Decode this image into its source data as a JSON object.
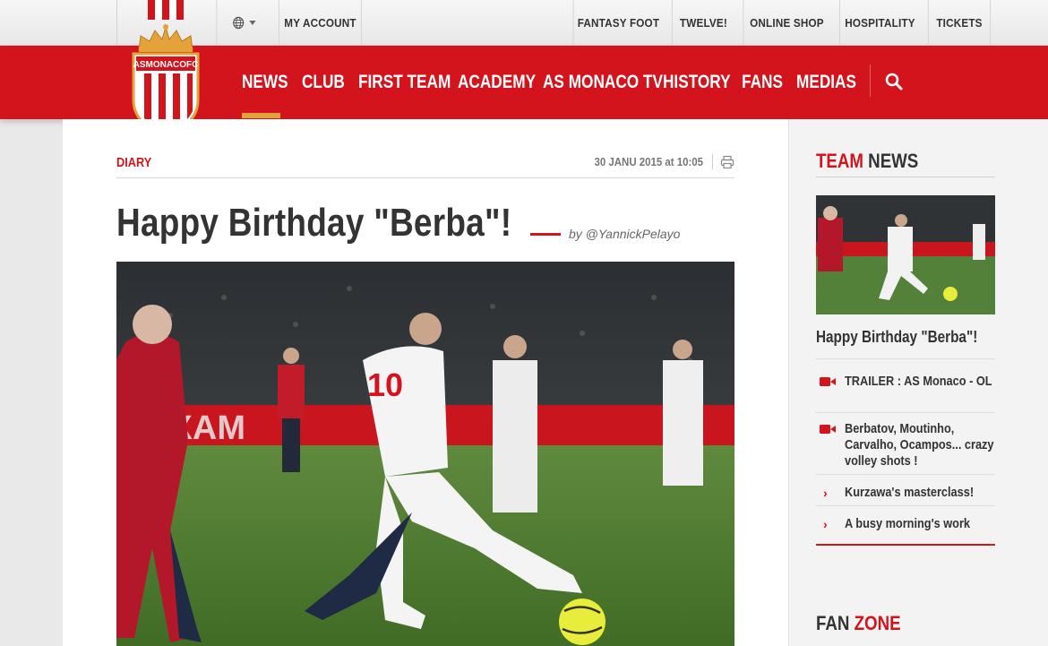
{
  "topbar": {
    "language_icon": "globe-icon",
    "my_account": "MY ACCOUNT",
    "links": [
      "FANTASY FOOT",
      "TWELVE!",
      "ONLINE SHOP",
      "HOSPITALITY",
      "TICKETS"
    ]
  },
  "brand": {
    "logo_text": "ASMONACOFC",
    "colors": {
      "red": "#d3141d",
      "gold": "#e3a23a",
      "white": "#ffffff"
    }
  },
  "nav": {
    "items": [
      "NEWS",
      "CLUB",
      "FIRST TEAM",
      "ACADEMY",
      "AS MONACO TV",
      "HISTORY",
      "FANS",
      "MEDIAS"
    ],
    "active": "NEWS",
    "search_icon": "search-icon"
  },
  "article": {
    "category": "DIARY",
    "date": "30 JANU 2015 at 10:05",
    "print_icon": "print-icon",
    "title": "Happy Birthday \"Berba\"!",
    "byline": "by @YannickPelayo",
    "photo_banner": "OXAM"
  },
  "sidebar": {
    "team_news": {
      "word1": "TEAM",
      "word2": "NEWS"
    },
    "featured_title": "Happy Birthday \"Berba\"!",
    "items": [
      {
        "icon": "video-camera-icon",
        "text": "TRAILER : AS Monaco - OL"
      },
      {
        "icon": "video-camera-icon",
        "text": "Berbatov, Moutinho, Carvalho, Ocampos... crazy volley shots !"
      },
      {
        "icon": "chevron-right-icon",
        "text": "Kurzawa's masterclass!"
      },
      {
        "icon": "chevron-right-icon",
        "text": "A busy morning's work"
      }
    ],
    "fan_zone": {
      "word1": "FAN",
      "word2": "ZONE"
    }
  }
}
